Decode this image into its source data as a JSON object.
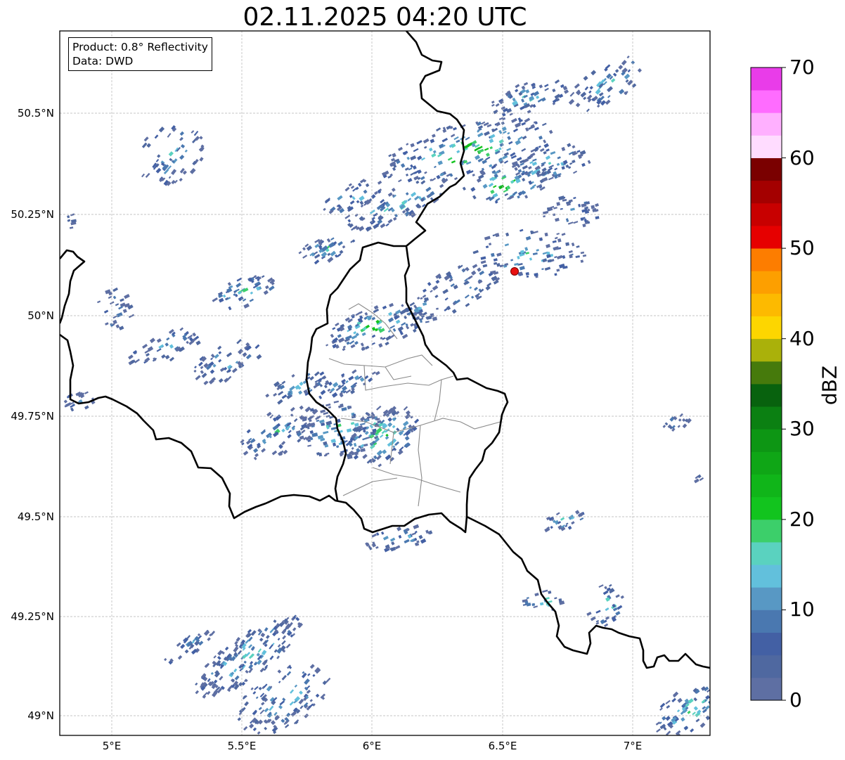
{
  "title": "02.11.2025 04:20 UTC",
  "info": {
    "product": "Product: 0.8° Reflectivity",
    "data": "Data: DWD"
  },
  "axes": {
    "lon_labels": [
      "5°E",
      "5.5°E",
      "6°E",
      "6.5°E",
      "7°E"
    ],
    "lat_labels": [
      "50.5°N",
      "50.25°N",
      "50°N",
      "49.75°N",
      "49.5°N",
      "49.25°N",
      "49°N"
    ]
  },
  "colorbar": {
    "label": "dBZ",
    "ticks": [
      "70",
      "60",
      "50",
      "40",
      "30",
      "20",
      "10",
      "0"
    ],
    "colors": [
      "#5e6fa3",
      "#4f68a0",
      "#4360a4",
      "#4a78b0",
      "#5898c4",
      "#62c0dc",
      "#5ad2bf",
      "#3ccf6a",
      "#12c41e",
      "#10b519",
      "#0fa616",
      "#0d9614",
      "#0b8012",
      "#08620e",
      "#467a0c",
      "#aab10a",
      "#fdd600",
      "#fdba00",
      "#fd9f00",
      "#fd7d00",
      "#e60000",
      "#c80000",
      "#a40000",
      "#7a0000",
      "#ffdcff",
      "#ffb0ff",
      "#ff6cff",
      "#e93ce9"
    ]
  },
  "colors": {
    "border": "#000000",
    "admin": "#8a8a8a",
    "grid": "#b3b3b3",
    "marker": "#e81010"
  }
}
